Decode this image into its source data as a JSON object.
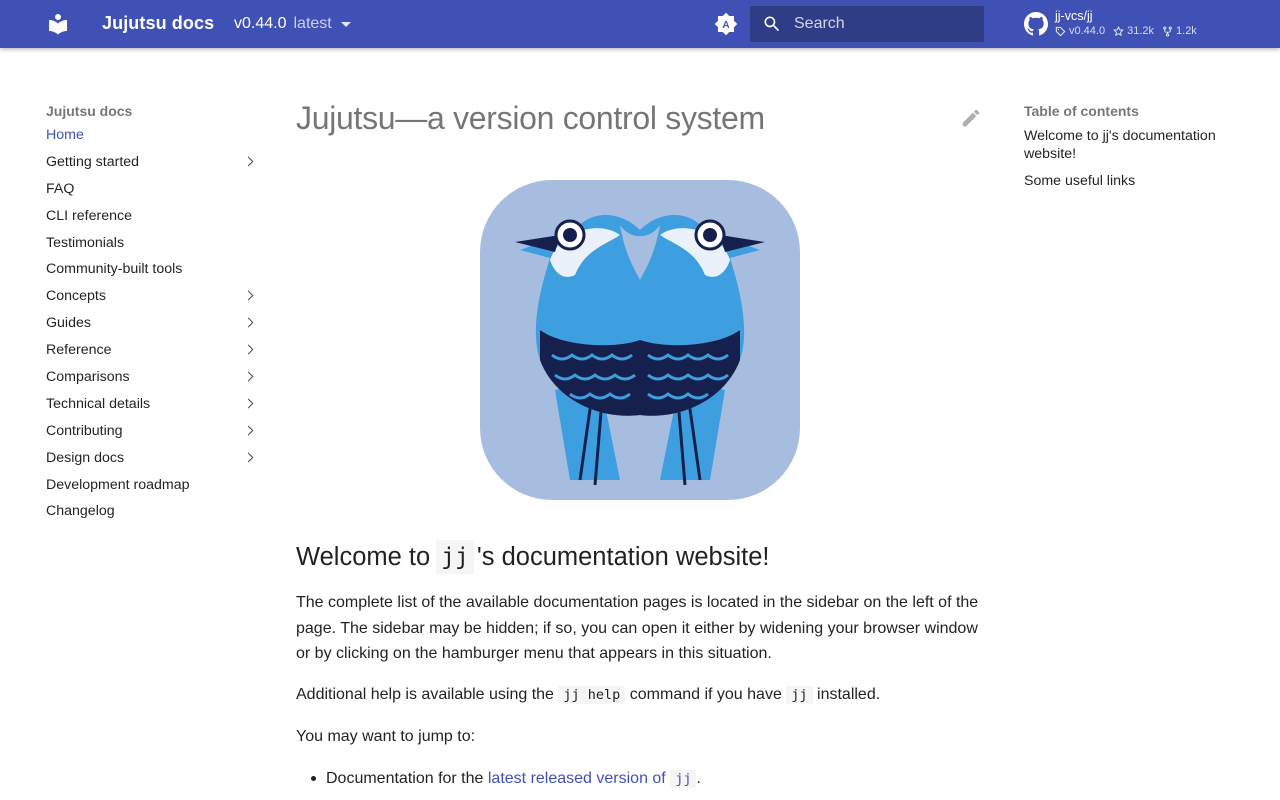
{
  "header": {
    "site_title": "Jujutsu docs",
    "version": "v0.44.0",
    "version_alias": "latest",
    "search_placeholder": "Search",
    "repo": {
      "name": "jj-vcs/jj",
      "tag": "v0.44.0",
      "stars": "31.2k",
      "forks": "1.2k"
    },
    "colors": {
      "primary": "#4051b5"
    }
  },
  "nav": {
    "title": "Jujutsu docs",
    "items": [
      {
        "label": "Home",
        "active": true,
        "expandable": false
      },
      {
        "label": "Getting started",
        "expandable": true
      },
      {
        "label": "FAQ",
        "expandable": false
      },
      {
        "label": "CLI reference",
        "expandable": false
      },
      {
        "label": "Testimonials",
        "expandable": false
      },
      {
        "label": "Community-built tools",
        "expandable": false
      },
      {
        "label": "Concepts",
        "expandable": true
      },
      {
        "label": "Guides",
        "expandable": true
      },
      {
        "label": "Reference",
        "expandable": true
      },
      {
        "label": "Comparisons",
        "expandable": true
      },
      {
        "label": "Technical details",
        "expandable": true
      },
      {
        "label": "Contributing",
        "expandable": true
      },
      {
        "label": "Design docs",
        "expandable": true
      },
      {
        "label": "Development roadmap",
        "expandable": false
      },
      {
        "label": "Changelog",
        "expandable": false
      }
    ]
  },
  "main": {
    "title": "Jujutsu—a version control system",
    "welcome": {
      "prefix": "Welcome to",
      "code": "jj",
      "suffix": "'s documentation website!"
    },
    "para1": "The complete list of the available documentation pages is located in the sidebar on the left of the page. The sidebar may be hidden; if so, you can open it either by widening your browser window or by clicking on the hamburger menu that appears in this situation.",
    "para2": {
      "prefix": "Additional help is available using the",
      "code1": "jj help",
      "middle": "command if you have",
      "code2": "jj",
      "suffix": "installed."
    },
    "para3": "You may want to jump to:",
    "bullet1": {
      "prefix": "Documentation for the",
      "link": "latest released version of",
      "code": "jj",
      "suffix": "."
    }
  },
  "toc": {
    "title": "Table of contents",
    "items": [
      "Welcome to jj's documentation website!",
      "Some useful links"
    ]
  }
}
